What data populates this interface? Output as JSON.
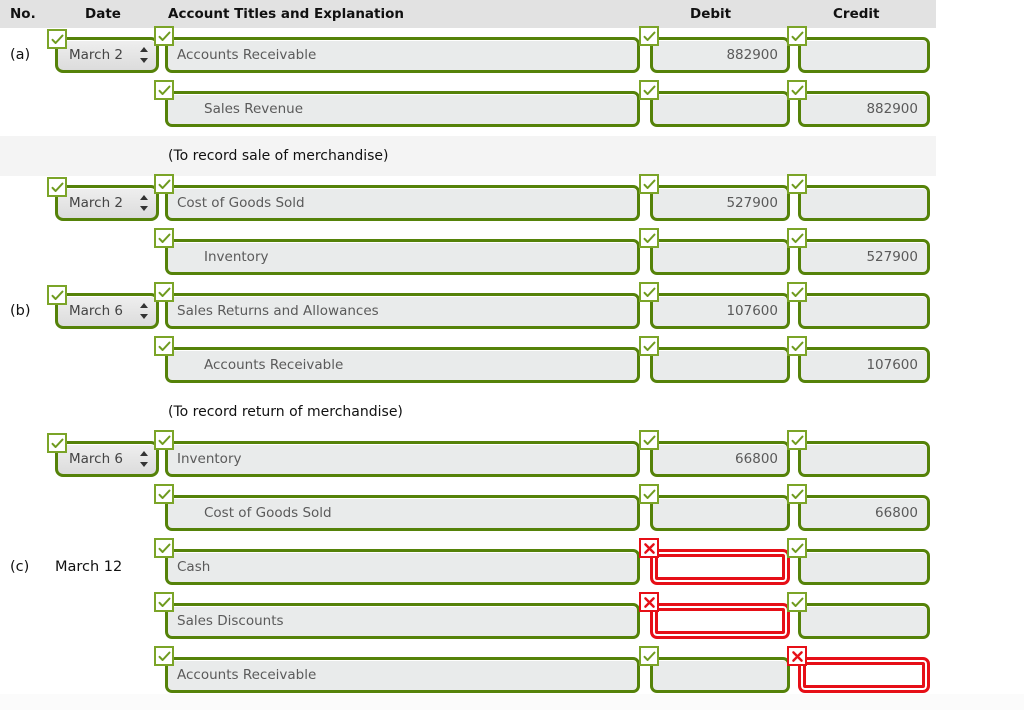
{
  "header": {
    "no": "No.",
    "date": "Date",
    "account": "Account Titles and Explanation",
    "debit": "Debit",
    "credit": "Credit"
  },
  "colors": {
    "valid_border": "#558209",
    "valid_badge_border": "#7ba428",
    "error_border": "#e60f17",
    "field_fill": "#e9ebeb",
    "header_band": "#e2e2e2",
    "stripe": "#f4f4f4",
    "field_text": "#5a5a5a"
  },
  "icons": {
    "valid": "check-icon",
    "invalid": "x-icon",
    "select": "updown-arrows-icon"
  },
  "rows": [
    {
      "kind": "entry",
      "letter": "(a)",
      "date_type": "select",
      "date": "March 2",
      "date_status": "valid",
      "account": "Accounts Receivable",
      "account_status": "valid",
      "indent": false,
      "debit": "882900",
      "debit_status": "valid",
      "credit": "",
      "credit_status": "valid",
      "stripe": false
    },
    {
      "kind": "entry",
      "letter": "",
      "date_type": "none",
      "date": "",
      "date_status": "",
      "account": "Sales Revenue",
      "account_status": "valid",
      "indent": true,
      "debit": "",
      "debit_status": "valid",
      "credit": "882900",
      "credit_status": "valid",
      "stripe": false
    },
    {
      "kind": "explanation",
      "letter": "",
      "date_type": "none",
      "date": "",
      "account": "(To record sale of merchandise)",
      "indent": false,
      "debit": "",
      "credit": "",
      "stripe": true
    },
    {
      "kind": "entry",
      "letter": "",
      "date_type": "select",
      "date": "March 2",
      "date_status": "valid",
      "account": "Cost of Goods Sold",
      "account_status": "valid",
      "indent": false,
      "debit": "527900",
      "debit_status": "valid",
      "credit": "",
      "credit_status": "valid",
      "stripe": false
    },
    {
      "kind": "entry",
      "letter": "",
      "date_type": "none",
      "date": "",
      "date_status": "",
      "account": "Inventory",
      "account_status": "valid",
      "indent": true,
      "debit": "",
      "debit_status": "valid",
      "credit": "527900",
      "credit_status": "valid",
      "stripe": false
    },
    {
      "kind": "entry",
      "letter": "(b)",
      "date_type": "select",
      "date": "March 6",
      "date_status": "valid",
      "account": "Sales Returns and Allowances",
      "account_status": "valid",
      "indent": false,
      "debit": "107600",
      "debit_status": "valid",
      "credit": "",
      "credit_status": "valid",
      "stripe": false
    },
    {
      "kind": "entry",
      "letter": "",
      "date_type": "none",
      "date": "",
      "date_status": "",
      "account": "Accounts Receivable",
      "account_status": "valid",
      "indent": true,
      "debit": "",
      "debit_status": "valid",
      "credit": "107600",
      "credit_status": "valid",
      "stripe": false
    },
    {
      "kind": "explanation",
      "letter": "",
      "date_type": "none",
      "date": "",
      "account": "(To record return of merchandise)",
      "indent": false,
      "debit": "",
      "credit": "",
      "stripe": false
    },
    {
      "kind": "entry",
      "letter": "",
      "date_type": "select",
      "date": "March 6",
      "date_status": "valid",
      "account": "Inventory",
      "account_status": "valid",
      "indent": false,
      "debit": "66800",
      "debit_status": "valid",
      "credit": "",
      "credit_status": "valid",
      "stripe": false
    },
    {
      "kind": "entry",
      "letter": "",
      "date_type": "none",
      "date": "",
      "date_status": "",
      "account": "Cost of Goods Sold",
      "account_status": "valid",
      "indent": true,
      "debit": "",
      "debit_status": "valid",
      "credit": "66800",
      "credit_status": "valid",
      "stripe": false
    },
    {
      "kind": "entry",
      "letter": "(c)",
      "date_type": "text",
      "date": "March 12",
      "date_status": "",
      "account": "Cash",
      "account_status": "valid",
      "indent": false,
      "debit": "",
      "debit_status": "invalid",
      "credit": "",
      "credit_status": "valid",
      "stripe": false
    },
    {
      "kind": "entry",
      "letter": "",
      "date_type": "none",
      "date": "",
      "date_status": "",
      "account": "Sales Discounts",
      "account_status": "valid",
      "indent": false,
      "debit": "",
      "debit_status": "invalid",
      "credit": "",
      "credit_status": "valid",
      "stripe": false
    },
    {
      "kind": "entry",
      "letter": "",
      "date_type": "none",
      "date": "",
      "date_status": "",
      "account": "Accounts Receivable",
      "account_status": "valid",
      "indent": false,
      "debit": "",
      "debit_status": "valid",
      "credit": "",
      "credit_status": "invalid",
      "stripe": false
    }
  ]
}
